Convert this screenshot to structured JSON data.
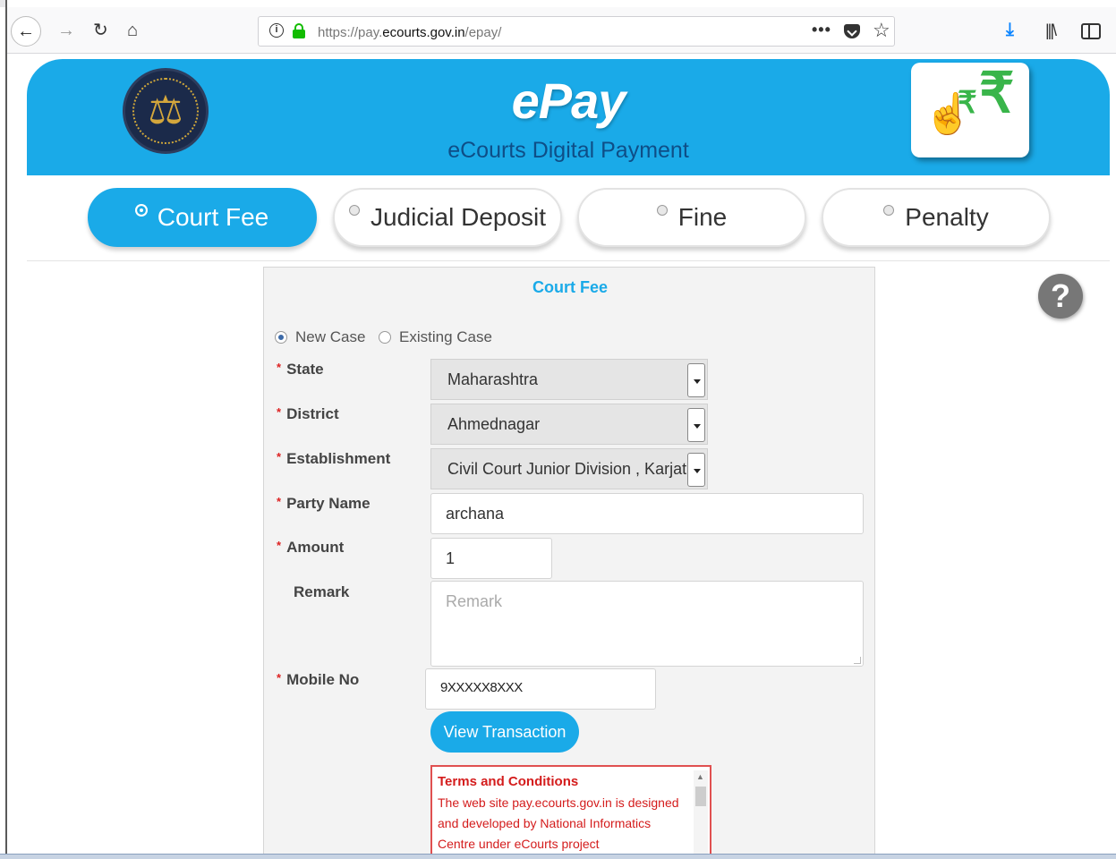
{
  "browser": {
    "url_prefix": "https://pay.",
    "url_domain": "ecourts.gov.in",
    "url_suffix": "/epay/",
    "more_label": "•••"
  },
  "header": {
    "title": "ePay",
    "subtitle": "eCourts Digital Payment"
  },
  "tabs": [
    {
      "label": "Court Fee",
      "active": true
    },
    {
      "label": "Judicial Deposit",
      "active": false
    },
    {
      "label": "Fine",
      "active": false
    },
    {
      "label": "Penalty",
      "active": false
    }
  ],
  "help_label": "?",
  "form": {
    "title": "Court Fee",
    "case_options": [
      {
        "label": "New Case",
        "selected": true
      },
      {
        "label": "Existing Case",
        "selected": false
      }
    ],
    "required_mark": "*",
    "state": {
      "label": "State",
      "value": "Maharashtra"
    },
    "district": {
      "label": "District",
      "value": "Ahmednagar"
    },
    "establishment": {
      "label": "Establishment",
      "value": "Civil Court Junior Division , Karjat"
    },
    "party_name": {
      "label": "Party Name",
      "value": "archana"
    },
    "amount": {
      "label": "Amount",
      "value": "1"
    },
    "remark": {
      "label": "Remark",
      "placeholder": "Remark"
    },
    "mobile": {
      "label": "Mobile No",
      "value": "9XXXXX8XXX"
    },
    "view_transaction_label": "View Transaction",
    "terms": {
      "title": "Terms and Conditions",
      "body": "The web site pay.ecourts.gov.in is designed and developed by National Informatics Centre under eCourts project"
    }
  },
  "colors": {
    "accent": "#1aaae8",
    "terms_red": "#d41c1c",
    "rupee_green": "#39b54a"
  }
}
